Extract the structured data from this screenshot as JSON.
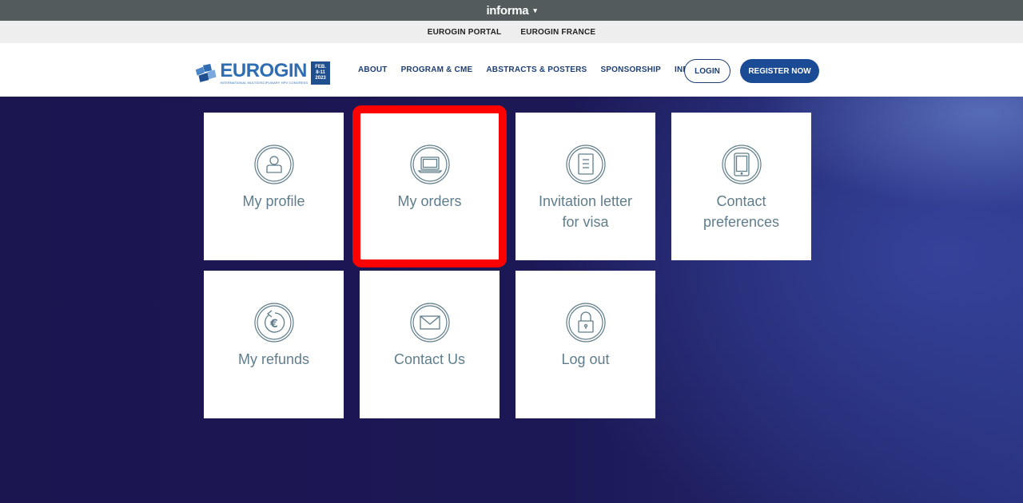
{
  "top_bar": {
    "brand": "informa",
    "caret": "▾"
  },
  "portal_links": [
    "EUROGIN PORTAL",
    "EUROGIN FRANCE"
  ],
  "header": {
    "logo": {
      "word": "EUROGIN",
      "subtitle": "INTERNATIONAL MULTIDISCIPLINARY HPV CONGRESS",
      "date_line1": "FEB.",
      "date_line2": "8-11",
      "date_line3": "2023"
    },
    "nav": [
      "ABOUT",
      "PROGRAM & CME",
      "ABSTRACTS & POSTERS",
      "SPONSORSHIP",
      "INFO"
    ],
    "login_label": "LOGIN",
    "register_label": "REGISTER NOW"
  },
  "tiles": [
    {
      "label": "My profile",
      "icon": "user-icon"
    },
    {
      "label": "My orders",
      "icon": "laptop-icon"
    },
    {
      "label": "Invitation letter\nfor visa",
      "icon": "document-icon"
    },
    {
      "label": "Contact\npreferences",
      "icon": "tablet-icon"
    },
    {
      "label": "My refunds",
      "icon": "euro-refund-icon"
    },
    {
      "label": "Contact Us",
      "icon": "envelope-icon"
    },
    {
      "label": "Log out",
      "icon": "lock-icon"
    }
  ],
  "colors": {
    "nav_text": "#1d3f74",
    "register_bg": "#1a4b94",
    "tile_text": "#607d8b",
    "highlight": "#ff0000",
    "background": "#1a1650"
  }
}
